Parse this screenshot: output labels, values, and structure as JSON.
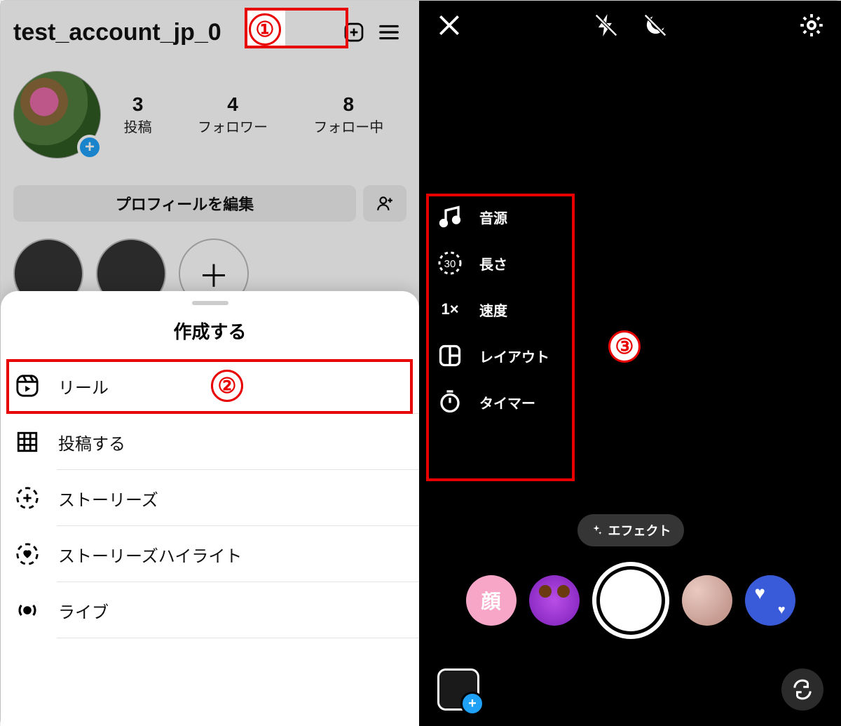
{
  "left": {
    "username": "test_account_jp_0",
    "stats": {
      "posts": {
        "count": "3",
        "label": "投稿"
      },
      "followers": {
        "count": "4",
        "label": "フォロワー"
      },
      "following": {
        "count": "8",
        "label": "フォロー中"
      }
    },
    "edit_button": "プロフィールを編集",
    "sheet": {
      "title": "作成する",
      "items": {
        "reel": "リール",
        "post": "投稿する",
        "story": "ストーリーズ",
        "story_highlight": "ストーリーズハイライト",
        "live": "ライブ"
      }
    }
  },
  "right": {
    "sidebar": {
      "audio": "音源",
      "length": "長さ",
      "length_value": "30",
      "speed": "速度",
      "speed_value": "1×",
      "layout": "レイアウト",
      "timer": "タイマー"
    },
    "effect_chip": "エフェクト",
    "face_filter_label": "顔"
  },
  "annotations": {
    "badge1": "①",
    "badge2": "②",
    "badge3": "③"
  }
}
